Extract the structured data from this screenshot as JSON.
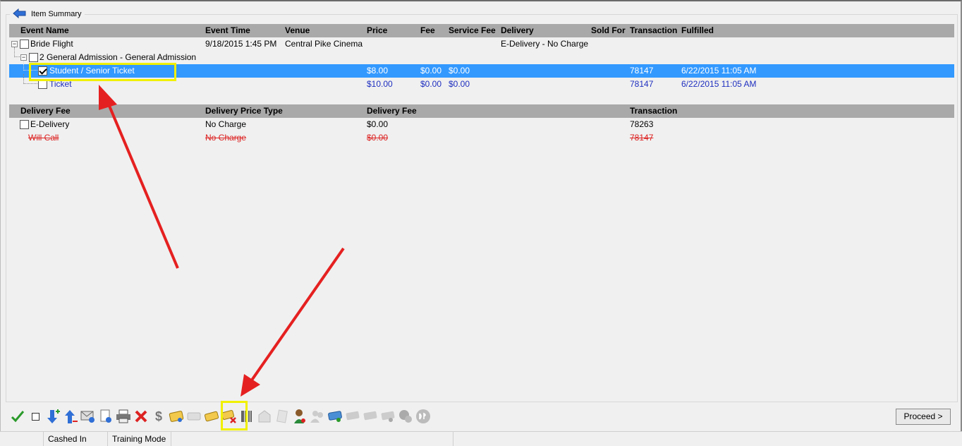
{
  "panel": {
    "title": "Item Summary"
  },
  "items_table": {
    "headers": [
      "Event Name",
      "Event Time",
      "Venue",
      "Price",
      "Fee",
      "Service Fee",
      "Delivery",
      "Sold For",
      "Transaction",
      "Fulfilled"
    ],
    "rows": [
      {
        "name": "Bride Flight",
        "time": "9/18/2015 1:45 PM",
        "venue": "Central Pike Cinema",
        "price": "",
        "fee": "",
        "service_fee": "",
        "delivery": "E-Delivery - No Charge",
        "sold_for": "",
        "transaction": "",
        "fulfilled": ""
      },
      {
        "name": "2 General Admission - General Admission"
      },
      {
        "name": "Student / Senior Ticket",
        "price": "$8.00",
        "fee": "$0.00",
        "service_fee": "$0.00",
        "transaction": "78147",
        "fulfilled": "6/22/2015 11:05 AM"
      },
      {
        "name": "Ticket",
        "price": "$10.00",
        "fee": "$0.00",
        "service_fee": "$0.00",
        "transaction": "78147",
        "fulfilled": "6/22/2015 11:05 AM"
      }
    ]
  },
  "delivery_table": {
    "headers": [
      "Delivery Fee",
      "Delivery Price Type",
      "Delivery Fee",
      "Transaction"
    ],
    "rows": [
      {
        "name": "E-Delivery",
        "price_type": "No Charge",
        "fee": "$0.00",
        "transaction": "78263"
      },
      {
        "name": "Will Call",
        "price_type": "No Charge",
        "fee": "$0.00",
        "transaction": "78147"
      }
    ]
  },
  "toolbar": {
    "icons": [
      "check-all-icon",
      "uncheck-icon",
      "move-down-icon",
      "move-up-icon",
      "email-info-icon",
      "document-info-icon",
      "printer-icon",
      "delete-icon",
      "dollar-icon",
      "ticket-refund-icon",
      "ticket-disabled-icon",
      "ticket-deliver-icon",
      "ticket-cancel-icon",
      "barcode-icon",
      "envelope-disabled-icon",
      "scroll-disabled-icon",
      "customer-icon",
      "users-disabled-icon",
      "ticket-exchange-icon",
      "ticket-remove-disabled-icon",
      "ticket-edit-disabled-icon",
      "ticket-info-disabled-icon",
      "help-disabled-icon",
      "dp-icon"
    ],
    "proceed_label": "Proceed >"
  },
  "status_bar": {
    "cashed": "Cashed In",
    "mode": "Training Mode"
  },
  "colors": {
    "selection": "#3399ff",
    "header": "#a9a9a9",
    "highlight": "#f0f000",
    "arrow": "#e52020",
    "link": "#1f2fbf"
  }
}
